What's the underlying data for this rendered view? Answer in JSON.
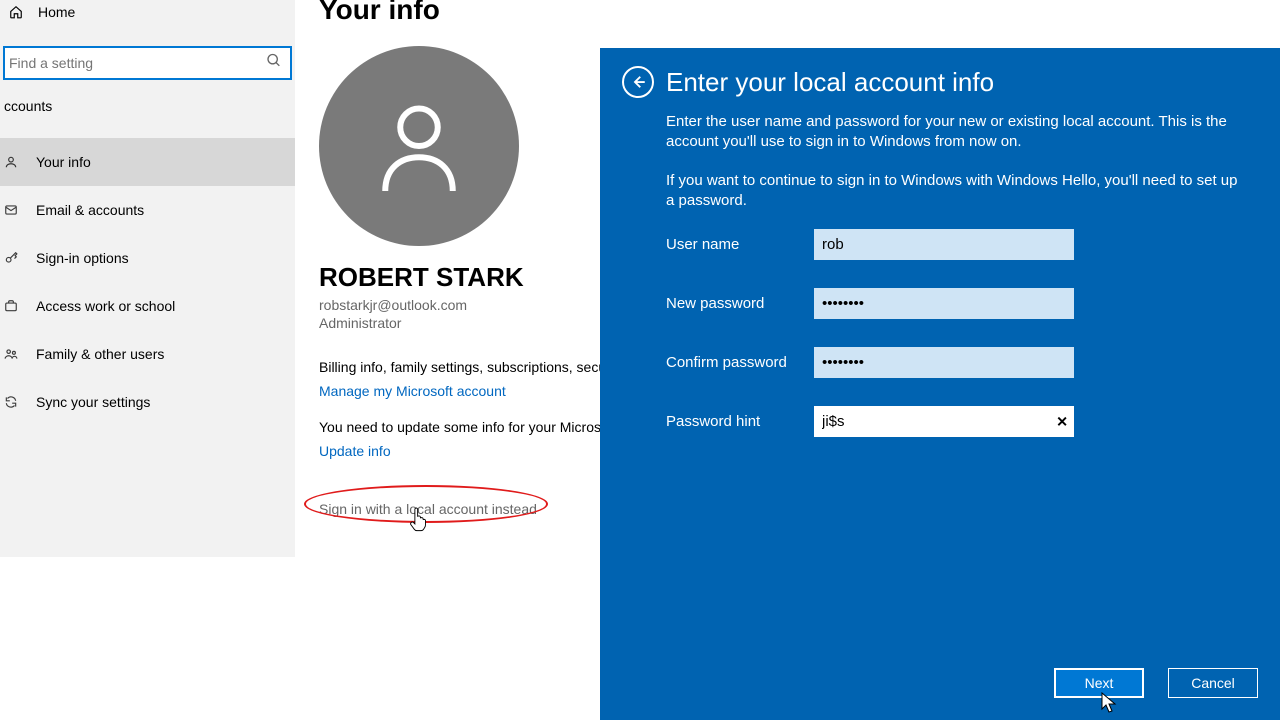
{
  "sidebar": {
    "home": "Home",
    "search_placeholder": "Find a setting",
    "section": "ccounts",
    "items": [
      {
        "label": "Your info"
      },
      {
        "label": "Email & accounts"
      },
      {
        "label": "Sign-in options"
      },
      {
        "label": "Access work or school"
      },
      {
        "label": "Family & other users"
      },
      {
        "label": "Sync your settings"
      }
    ]
  },
  "content": {
    "title": "Your info",
    "user_name": "ROBERT STARK",
    "user_email": "robstarkjr@outlook.com",
    "user_role": "Administrator",
    "billing_line": "Billing info, family settings, subscriptions, secu",
    "manage_link": "Manage my Microsoft account",
    "update_line": "You need to update some info for your Micros",
    "update_link": "Update info",
    "local_account_link": "Sign in with a local account instead"
  },
  "dialog": {
    "title": "Enter your local account info",
    "p1": "Enter the user name and password for your new or existing local account. This is the account you'll use to sign in to Windows from now on.",
    "p2": "If you want to continue to sign in to Windows with Windows Hello, you'll need to set up a password.",
    "labels": {
      "username": "User name",
      "new_password": "New password",
      "confirm_password": "Confirm password",
      "hint": "Password hint"
    },
    "values": {
      "username": "rob",
      "new_password": "••••••••",
      "confirm_password": "••••••••",
      "hint": "ji$s"
    },
    "buttons": {
      "next": "Next",
      "cancel": "Cancel"
    }
  }
}
